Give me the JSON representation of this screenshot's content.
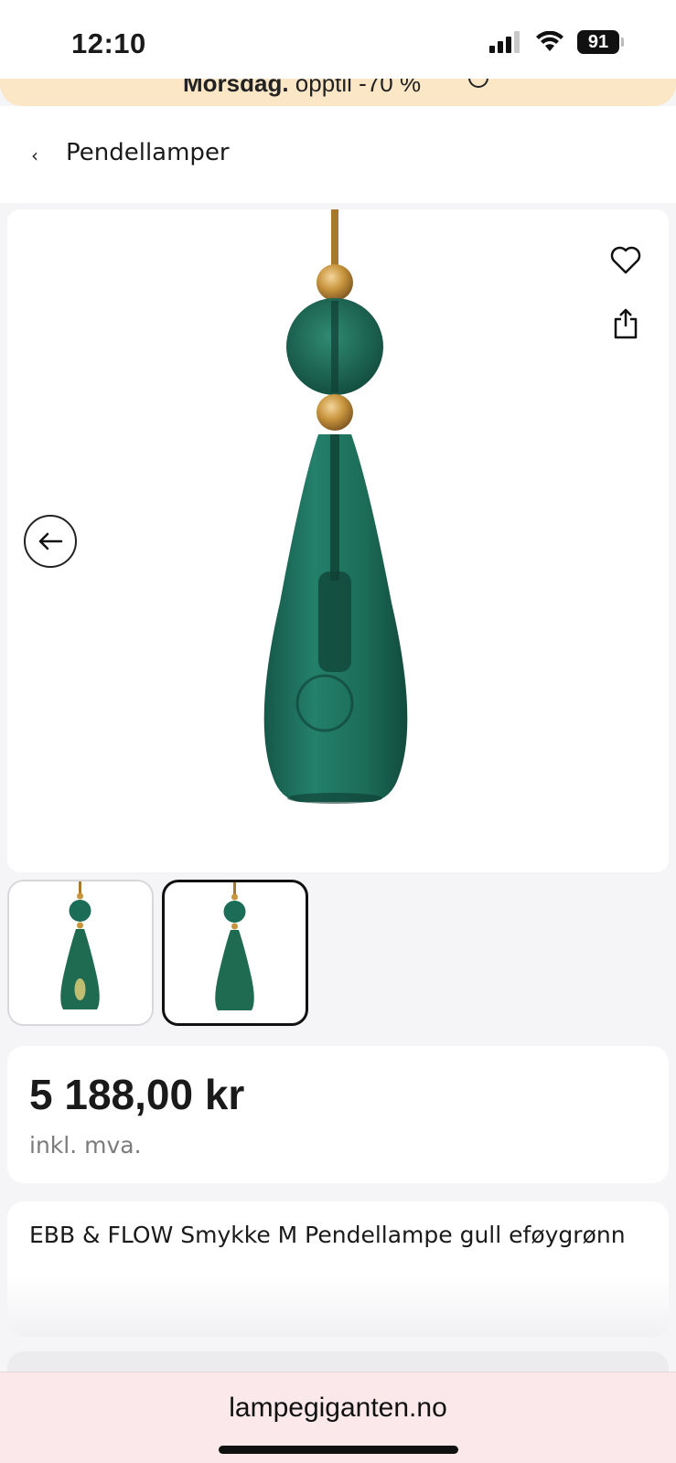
{
  "status_bar": {
    "time": "12:10",
    "battery": "91",
    "icons": [
      "signal-icon",
      "wifi-icon",
      "battery-icon"
    ]
  },
  "promo_banner": {
    "bold_text": "Morsdag.",
    "text": " opptil -70 %",
    "icon": "info-icon",
    "background": "#fbe7c6"
  },
  "nav": {
    "back_icon": "chevron-left-icon",
    "title": "Pendellamper"
  },
  "gallery": {
    "icons": [
      "heart-icon",
      "share-icon",
      "arrow-left-icon"
    ],
    "thumbnails": [
      {
        "selected": false
      },
      {
        "selected": true
      }
    ],
    "lamp_color": "#1e6b52",
    "accent_gold": "#c8953d"
  },
  "price": {
    "amount": "5 188,00 kr",
    "vat_note": "inkl. mva."
  },
  "product": {
    "title": "EBB & FLOW Smykke M Pendellampe gull eføygrønn"
  },
  "browser": {
    "url": "lampegiganten.no"
  }
}
